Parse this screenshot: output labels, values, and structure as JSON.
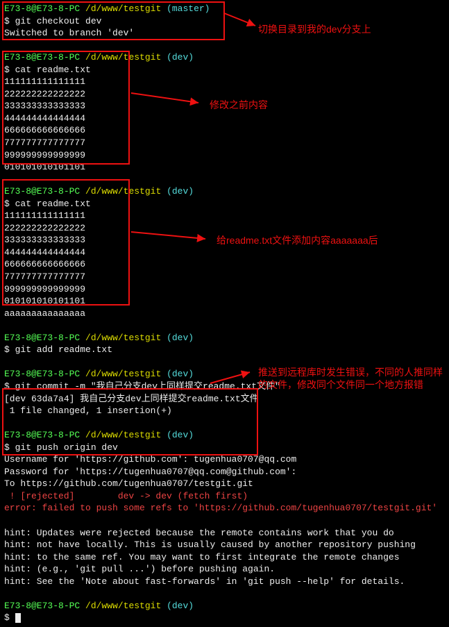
{
  "colors": {
    "prompt_user": "#5f5",
    "prompt_path": "#dd0",
    "prompt_branch": "#5dd",
    "error": "#e44",
    "annot": "#e11"
  },
  "blocks": {
    "b1": {
      "prompt_user": "E73-8@E73-8-PC ",
      "prompt_path": "/d/www/testgit ",
      "prompt_branch": "(master)",
      "cmd": "$ git checkout dev",
      "out1": "Switched to branch 'dev'"
    },
    "b2": {
      "prompt_user": "E73-8@E73-8-PC ",
      "prompt_path": "/d/www/testgit ",
      "prompt_branch": "(dev)",
      "cmd": "$ cat readme.txt",
      "lines": [
        "111111111111111",
        "222222222222222",
        "333333333333333",
        "444444444444444",
        "666666666666666",
        "777777777777777",
        "999999999999999",
        "010101010101101"
      ]
    },
    "b3": {
      "prompt_user": "E73-8@E73-8-PC ",
      "prompt_path": "/d/www/testgit ",
      "prompt_branch": "(dev)",
      "cmd": "$ cat readme.txt",
      "lines": [
        "111111111111111",
        "222222222222222",
        "333333333333333",
        "444444444444444",
        "666666666666666",
        "777777777777777",
        "999999999999999",
        "010101010101101",
        "aaaaaaaaaaaaaaa"
      ]
    },
    "b4": {
      "prompt_user": "E73-8@E73-8-PC ",
      "prompt_path": "/d/www/testgit ",
      "prompt_branch": "(dev)",
      "cmd": "$ git add readme.txt"
    },
    "b5": {
      "prompt_user": "E73-8@E73-8-PC ",
      "prompt_path": "/d/www/testgit ",
      "prompt_branch": "(dev)",
      "cmd": "$ git commit -m \"我自己分支dev上同样提交readme.txt文件\"",
      "out1": "[dev 63da7a4] 我自己分支dev上同样提交readme.txt文件",
      "out2": " 1 file changed, 1 insertion(+)"
    },
    "b6": {
      "prompt_user": "E73-8@E73-8-PC ",
      "prompt_path": "/d/www/testgit ",
      "prompt_branch": "(dev)",
      "cmd": "$ git push origin dev",
      "out1": "Username for 'https://github.com': tugenhua0707@qq.com",
      "out2": "Password for 'https://tugenhua0707@qq.com@github.com':",
      "out3": "To https://github.com/tugenhua0707/testgit.git",
      "out4": " ! [rejected]        dev -> dev (fetch first)",
      "out5": "error: failed to push some refs to 'https://github.com/tugenhua0707/testgit.git'"
    },
    "hints": {
      "h1": "hint: Updates were rejected because the remote contains work that you do",
      "h2": "hint: not have locally. This is usually caused by another repository pushing",
      "h3": "hint: to the same ref. You may want to first integrate the remote changes",
      "h4": "hint: (e.g., 'git pull ...') before pushing again.",
      "h5": "hint: See the 'Note about fast-forwards' in 'git push --help' for details."
    },
    "b7": {
      "prompt_user": "E73-8@E73-8-PC ",
      "prompt_path": "/d/www/testgit ",
      "prompt_branch": "(dev)",
      "cmd": "$ "
    }
  },
  "annotations": {
    "a1": "切换目录到我的dev分支上",
    "a2": "修改之前内容",
    "a3": "给readme.txt文件添加内容aaaaaaa后",
    "a4_l1": "推送到远程库时发生错误，不同的人推同样",
    "a4_l2": "的文件，修改同个文件同一个地方报错"
  }
}
